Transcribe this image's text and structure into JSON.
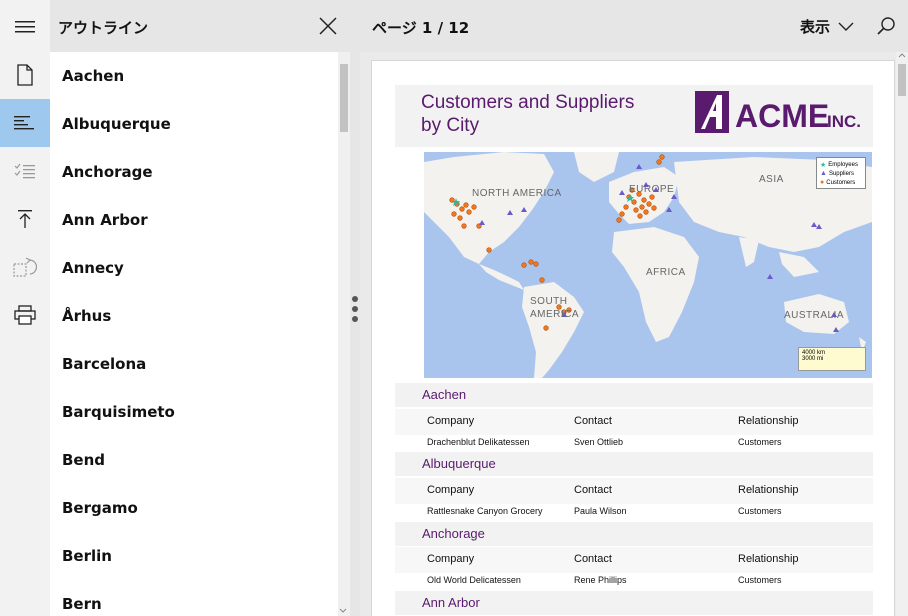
{
  "outline": {
    "title": "アウトライン",
    "items": [
      {
        "label": "Aachen"
      },
      {
        "label": "Albuquerque"
      },
      {
        "label": "Anchorage"
      },
      {
        "label": "Ann Arbor"
      },
      {
        "label": "Annecy"
      },
      {
        "label": "Århus"
      },
      {
        "label": "Barcelona"
      },
      {
        "label": "Barquisimeto"
      },
      {
        "label": "Bend"
      },
      {
        "label": "Bergamo"
      },
      {
        "label": "Berlin"
      },
      {
        "label": "Bern"
      }
    ]
  },
  "rail": {
    "icons": [
      "document-icon",
      "outline-icon",
      "checklist-icon",
      "export-icon",
      "rotate-icon",
      "print-icon"
    ],
    "active_index": 1
  },
  "viewer": {
    "page_indicator": "ページ 1 / 12",
    "view_menu_label": "表示"
  },
  "report": {
    "title_line1": "Customers and Suppliers",
    "title_line2": "by City",
    "logo_text": "ACME",
    "logo_suffix": "INC.",
    "map": {
      "labels": [
        "NORTH AMERICA",
        "EUROPE",
        "ASIA",
        "AFRICA",
        "SOUTH AMERICA",
        "AUSTRALIA"
      ],
      "legend": [
        "Employees",
        "Suppliers",
        "Customers"
      ],
      "scale_km": "4000 km",
      "scale_mi": "3000 mi"
    },
    "column_headers": {
      "company": "Company",
      "contact": "Contact",
      "relationship": "Relationship"
    },
    "sections": [
      {
        "city": "Aachen",
        "rows": [
          {
            "company": "Drachenblut Delikatessen",
            "contact": "Sven Ottlieb",
            "relationship": "Customers"
          }
        ]
      },
      {
        "city": "Albuquerque",
        "rows": [
          {
            "company": "Rattlesnake Canyon Grocery",
            "contact": "Paula Wilson",
            "relationship": "Customers"
          }
        ]
      },
      {
        "city": "Anchorage",
        "rows": [
          {
            "company": "Old World Delicatessen",
            "contact": "Rene Phillips",
            "relationship": "Customers"
          }
        ]
      },
      {
        "city": "Ann Arbor",
        "rows": []
      }
    ]
  },
  "colors": {
    "accent_purple": "#5a1a6e",
    "selected_rail": "#9ec8ee",
    "map_water": "#a9c5ee",
    "customer_dot": "#f07820",
    "supplier_triangle": "#6a5acd",
    "employee_star": "#2eb89a"
  }
}
